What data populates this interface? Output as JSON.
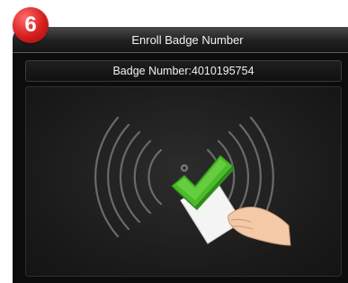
{
  "step": {
    "number": "6",
    "color": "#d51d1d"
  },
  "header": {
    "title": "Enroll Badge Number"
  },
  "badge": {
    "label": "Badge Number:4010195754"
  },
  "illustration": {
    "icons": [
      "rfid-waves-icon",
      "card-icon",
      "hand-icon",
      "checkmark-icon"
    ],
    "check_color": "#4cbb2b"
  }
}
